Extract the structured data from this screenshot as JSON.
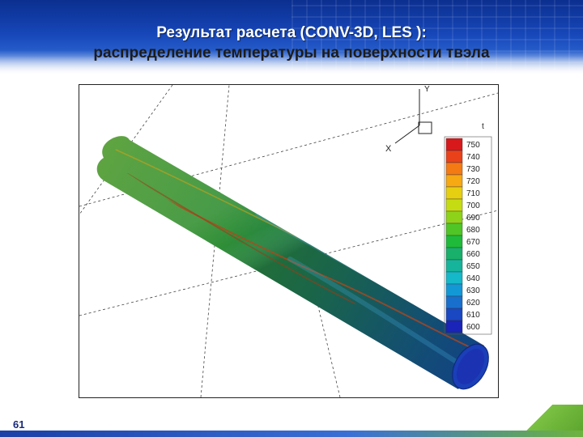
{
  "slide": {
    "title_line1": "Результат расчета (CONV-3D, LES ):",
    "title_line2": "распределение температуры на поверхности твэла",
    "slide_number": "61"
  },
  "plot": {
    "axes": {
      "y_label": "Y",
      "x_label": "X"
    },
    "legend": {
      "title": "t",
      "levels": [
        {
          "label": "750",
          "color": "#d7191c"
        },
        {
          "label": "740",
          "color": "#e9421a"
        },
        {
          "label": "730",
          "color": "#f47a14"
        },
        {
          "label": "720",
          "color": "#f6a912"
        },
        {
          "label": "710",
          "color": "#e6cf10"
        },
        {
          "label": "700",
          "color": "#c6dc12"
        },
        {
          "label": "690",
          "color": "#8fd21a"
        },
        {
          "label": "680",
          "color": "#4fc626"
        },
        {
          "label": "670",
          "color": "#1fba3a"
        },
        {
          "label": "660",
          "color": "#18b06a"
        },
        {
          "label": "650",
          "color": "#16b49a"
        },
        {
          "label": "640",
          "color": "#14b8c8"
        },
        {
          "label": "630",
          "color": "#1398d6"
        },
        {
          "label": "620",
          "color": "#1870cc"
        },
        {
          "label": "610",
          "color": "#1a48c2"
        },
        {
          "label": "600",
          "color": "#1a24b8"
        }
      ]
    }
  }
}
